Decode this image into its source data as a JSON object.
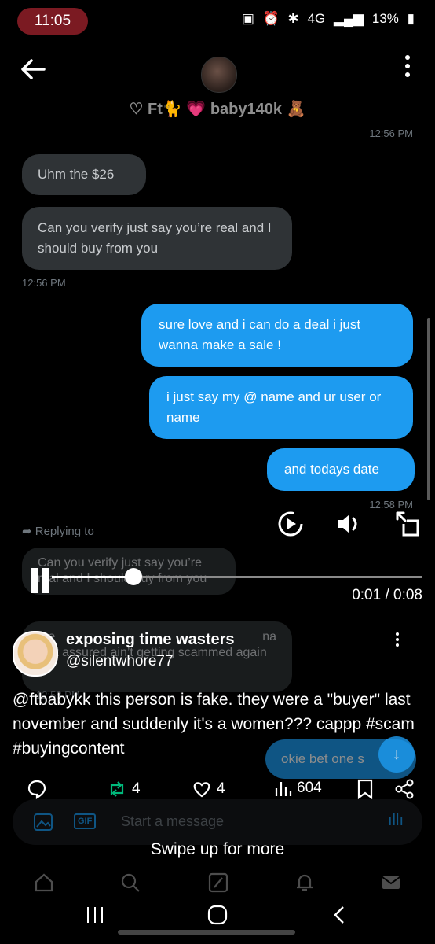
{
  "status_bar": {
    "time": "11:05",
    "network": "4G",
    "battery": "13%"
  },
  "dm": {
    "contact_name": "♡ Ft🐈 💗 baby140k 🧸",
    "timestamp_top": "12:56 PM",
    "messages_in": [
      {
        "text": "Uhm the $26"
      },
      {
        "text": "Can you verify just say you’re real and I should buy from you"
      }
    ],
    "timestamp_in": "12:56 PM",
    "messages_out": [
      {
        "text": "sure love and i can do a deal i just wanna make a sale !"
      },
      {
        "text": "i just say my @ name and ur user or name"
      },
      {
        "text": "and todays date"
      }
    ],
    "timestamp_out": "12:58 PM",
    "replying_to": "Replying to",
    "reply_quote": "Can you verify just say you’re real and I should buy from you",
    "faded_out_1": "ate",
    "faded_out_2": "na",
    "faded_out_3": "rest assured ain’t getting scammed again",
    "faded_ts": "12:58 PM",
    "faded_out_4": "okie bet one s",
    "composer_placeholder": "Start a message"
  },
  "video": {
    "progress_fraction": 0.22,
    "time_display": "0:01 / 0:08"
  },
  "post": {
    "author_name": "exposing time wasters",
    "author_handle": "@silentwhore77",
    "text": "@ftbabykk this person is fake. they were a \"buyer\" last november and suddenly it's a women??? cappp #scam #buyingcontent",
    "reposts": "4",
    "likes": "4",
    "views": "604"
  },
  "swipe_hint": "Swipe up for more",
  "colors": {
    "accent_blue": "#1d9bf0",
    "bubble_gray": "#2f3336",
    "repost_green": "#00ba7c",
    "status_pill": "#7b1a22"
  }
}
